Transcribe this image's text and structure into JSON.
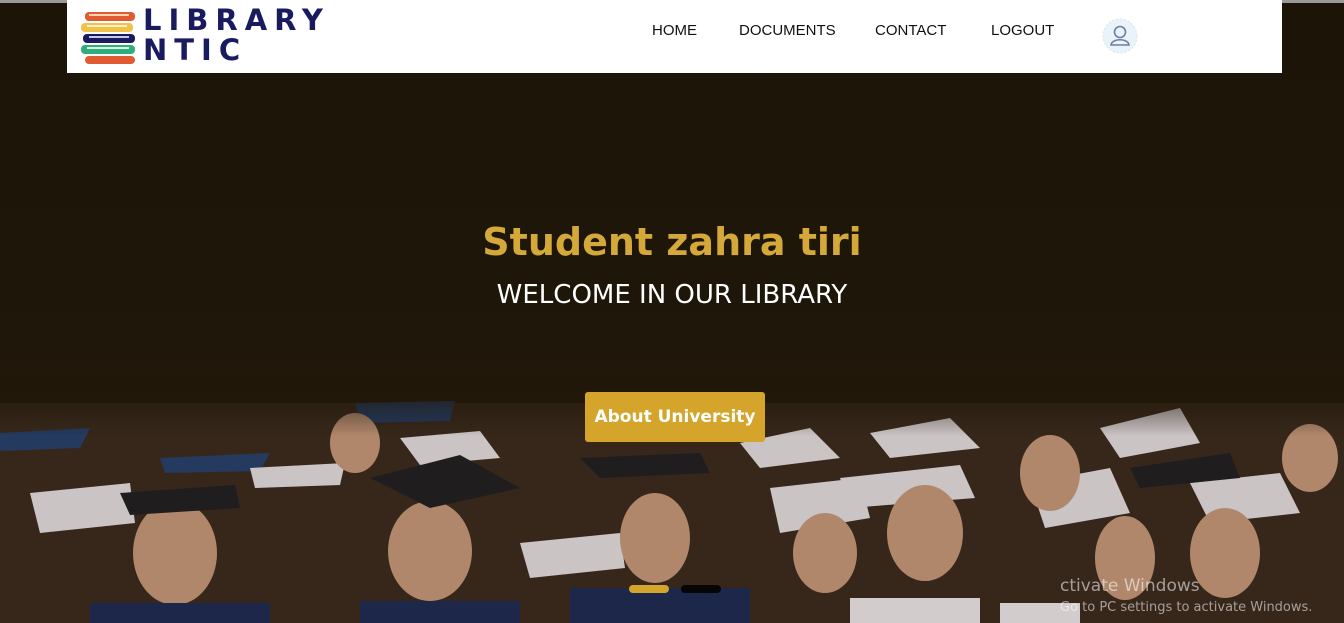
{
  "logo": {
    "line1": "LIBRARY",
    "line2": "NTIC",
    "icon": "books-stack-icon"
  },
  "nav": {
    "items": [
      {
        "label": "HOME"
      },
      {
        "label": "DOCUMENTS"
      },
      {
        "label": "CONTACT"
      },
      {
        "label": "LOGOUT"
      }
    ],
    "avatar_icon": "user-avatar-icon"
  },
  "hero": {
    "title": "Student zahra tiri",
    "subtitle": "WELCOME IN OUR LIBRARY",
    "button_label": "About University",
    "background": "graduation-crowd-photo",
    "carousel": {
      "slides": 2,
      "active": 1
    }
  },
  "watermark": {
    "line1": "ctivate Windows",
    "line2": "Go to PC settings to activate Windows."
  },
  "colors": {
    "accent": "#d4a52a",
    "title": "#d4a93a",
    "logo_text": "#1a1a5e",
    "navbar_bg": "#ffffff",
    "hero_bg": "#1d1608"
  }
}
